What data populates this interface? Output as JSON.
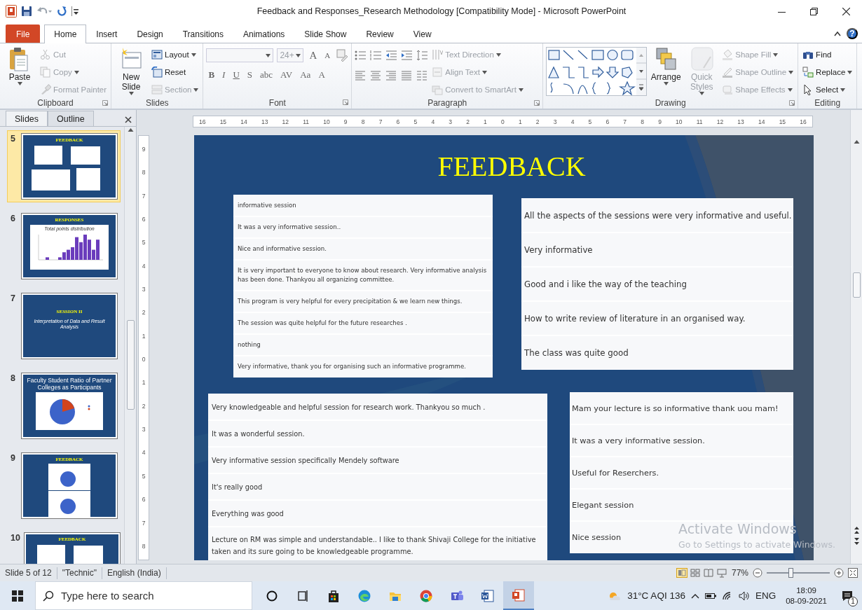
{
  "window": {
    "title": "Feedback and Responses_Research Methodology [Compatibility Mode]  -  Microsoft PowerPoint"
  },
  "tabs": [
    {
      "label": "File",
      "kind": "file",
      "selected": false
    },
    {
      "label": "Home",
      "kind": "tab",
      "selected": true
    },
    {
      "label": "Insert",
      "kind": "tab",
      "selected": false
    },
    {
      "label": "Design",
      "kind": "tab",
      "selected": false
    },
    {
      "label": "Transitions",
      "kind": "tab",
      "selected": false
    },
    {
      "label": "Animations",
      "kind": "tab",
      "selected": false
    },
    {
      "label": "Slide Show",
      "kind": "tab",
      "selected": false
    },
    {
      "label": "Review",
      "kind": "tab",
      "selected": false
    },
    {
      "label": "View",
      "kind": "tab",
      "selected": false
    }
  ],
  "help": "?",
  "ribbon": {
    "groups": [
      {
        "label": "Clipboard",
        "kind": "standard",
        "launcher": true,
        "large": [
          {
            "label": "Paste",
            "menu": true,
            "disabled": false
          }
        ],
        "small": [
          {
            "label": "Cut",
            "menu": false,
            "disabled": true
          },
          {
            "label": "Copy",
            "menu": true,
            "disabled": true
          },
          {
            "label": "Format Painter",
            "menu": false,
            "disabled": true
          }
        ]
      },
      {
        "label": "Slides",
        "kind": "standard",
        "launcher": false,
        "large": [
          {
            "label": "New Slide",
            "menu": true,
            "disabled": false
          }
        ],
        "small": [
          {
            "label": "Layout",
            "menu": true,
            "disabled": false
          },
          {
            "label": "Reset",
            "menu": false,
            "disabled": false
          },
          {
            "label": "Section",
            "menu": true,
            "disabled": true
          }
        ]
      },
      {
        "label": "Font",
        "kind": "font",
        "launcher": true,
        "font_size": "24+",
        "size_glyphs": [
          "A",
          "A"
        ],
        "glyphs": [
          "B",
          "I",
          "U",
          "S",
          "abc",
          "AV",
          "Aa",
          "A"
        ]
      },
      {
        "label": "Paragraph",
        "kind": "paragraph",
        "launcher": true,
        "small": [
          {
            "label": "Text Direction",
            "menu": true,
            "disabled": true
          },
          {
            "label": "Align Text",
            "menu": true,
            "disabled": true
          },
          {
            "label": "Convert to SmartArt",
            "menu": true,
            "disabled": true
          }
        ]
      },
      {
        "label": "Drawing",
        "kind": "drawing",
        "launcher": true,
        "large": [
          {
            "label": "Arrange",
            "menu": true,
            "disabled": false
          },
          {
            "label": "Quick Styles",
            "menu": true,
            "disabled": true
          }
        ],
        "small": [
          {
            "label": "Shape Fill",
            "menu": true,
            "disabled": true
          },
          {
            "label": "Shape Outline",
            "menu": true,
            "disabled": true
          },
          {
            "label": "Shape Effects",
            "menu": true,
            "disabled": true
          }
        ]
      },
      {
        "label": "Editing",
        "kind": "standard",
        "launcher": false,
        "small": [
          {
            "label": "Find",
            "menu": false,
            "disabled": false
          },
          {
            "label": "Replace",
            "menu": true,
            "disabled": false
          },
          {
            "label": "Select",
            "menu": true,
            "disabled": false
          }
        ]
      }
    ]
  },
  "side_panel": {
    "tabs": [
      {
        "label": "Slides",
        "selected": true
      },
      {
        "label": "Outline",
        "selected": false
      }
    ],
    "thumbnails": [
      {
        "number": "5",
        "kind": "feedback",
        "title": "FEEDBACK",
        "selected": true
      },
      {
        "number": "6",
        "kind": "chart",
        "title": "RESPONSES",
        "caption": "Total points distribution",
        "selected": false
      },
      {
        "number": "7",
        "kind": "session",
        "title": "SESSION  II",
        "caption": "Interpretation of Data and Result Analysis",
        "selected": false
      },
      {
        "number": "8",
        "kind": "pie",
        "title": "Faculty Student Ratio of Partner Colleges as Participants",
        "selected": false
      },
      {
        "number": "9",
        "kind": "pies",
        "title": "FEEDBACK",
        "selected": false
      },
      {
        "number": "10",
        "kind": "feedback",
        "title": "FEEDBACK",
        "selected": false
      }
    ]
  },
  "rulers": {
    "horizontal": [
      "16",
      "15",
      "14",
      "13",
      "12",
      "11",
      "10",
      "9",
      "8",
      "7",
      "6",
      "5",
      "4",
      "3",
      "2",
      "1",
      "0",
      "1",
      "2",
      "3",
      "4",
      "5",
      "6",
      "7",
      "8",
      "9",
      "10",
      "11",
      "12",
      "13",
      "14",
      "15",
      "16"
    ],
    "vertical": [
      "9",
      "8",
      "7",
      "6",
      "5",
      "4",
      "3",
      "2",
      "1",
      "0",
      "1",
      "2",
      "3",
      "4",
      "5",
      "6",
      "7",
      "8"
    ]
  },
  "slide": {
    "title": "FEEDBACK",
    "panels": [
      {
        "rows": [
          "informative session",
          "It was a very informative session..",
          "Nice and informative session.",
          "It is very important to everyone to know about research. Very informative analysis has been done. Thankyou all organizing committee.",
          "This program is very helpful for every precipitation & we learn new things.",
          "The session was quite helpful for the future researches .",
          "nothing",
          "Very informative, thank you for organising such an informative programme."
        ]
      },
      {
        "rows": [
          "All the aspects of the sessions were very informative and useful.",
          "Very informative",
          "Good and i like the way of the teaching",
          "How to write review of literature in an organised way.",
          "The class was quite good"
        ]
      },
      {
        "rows": [
          "Very knowledgeable and helpful session for research work. Thankyou so much .",
          "It was a wonderful session.",
          "Very informative session specifically Mendely software",
          "It's really good",
          "Everything was good",
          "Lecture on RM was simple and understandable.. I like to thank Shivaji College for the initiative taken and its sure going to be knowledgeable programme."
        ]
      },
      {
        "rows": [
          "Mam your lecture is so informative thank uou mam!",
          "It was a very informative session.",
          "Useful for Reserchers.",
          "Elegant session",
          "Nice session"
        ]
      }
    ]
  },
  "activation": {
    "title": "Activate Windows",
    "message": "Go to Settings to activate Windows."
  },
  "status_bar": {
    "items": [
      "Slide 5 of 12",
      "\"Technic\"",
      "English (India)"
    ],
    "zoom": "77%",
    "zoom_level": {
      "level": 0.38
    }
  },
  "taskbar": {
    "search": {
      "placeholder": "Type here to search"
    },
    "apps": [
      {
        "kind": "cortana",
        "selected": false
      },
      {
        "kind": "taskview",
        "selected": false
      },
      {
        "kind": "store",
        "selected": false
      },
      {
        "kind": "edge",
        "selected": false
      },
      {
        "kind": "explorer",
        "selected": false
      },
      {
        "kind": "chrome",
        "selected": false
      },
      {
        "kind": "teams",
        "selected": false
      },
      {
        "kind": "word",
        "selected": false
      },
      {
        "kind": "powerpoint",
        "selected": true
      }
    ],
    "weather": "31°C  AQI 136",
    "language": "ENG",
    "time": "18:09",
    "date": "08-09-2021",
    "notifications": "1"
  }
}
